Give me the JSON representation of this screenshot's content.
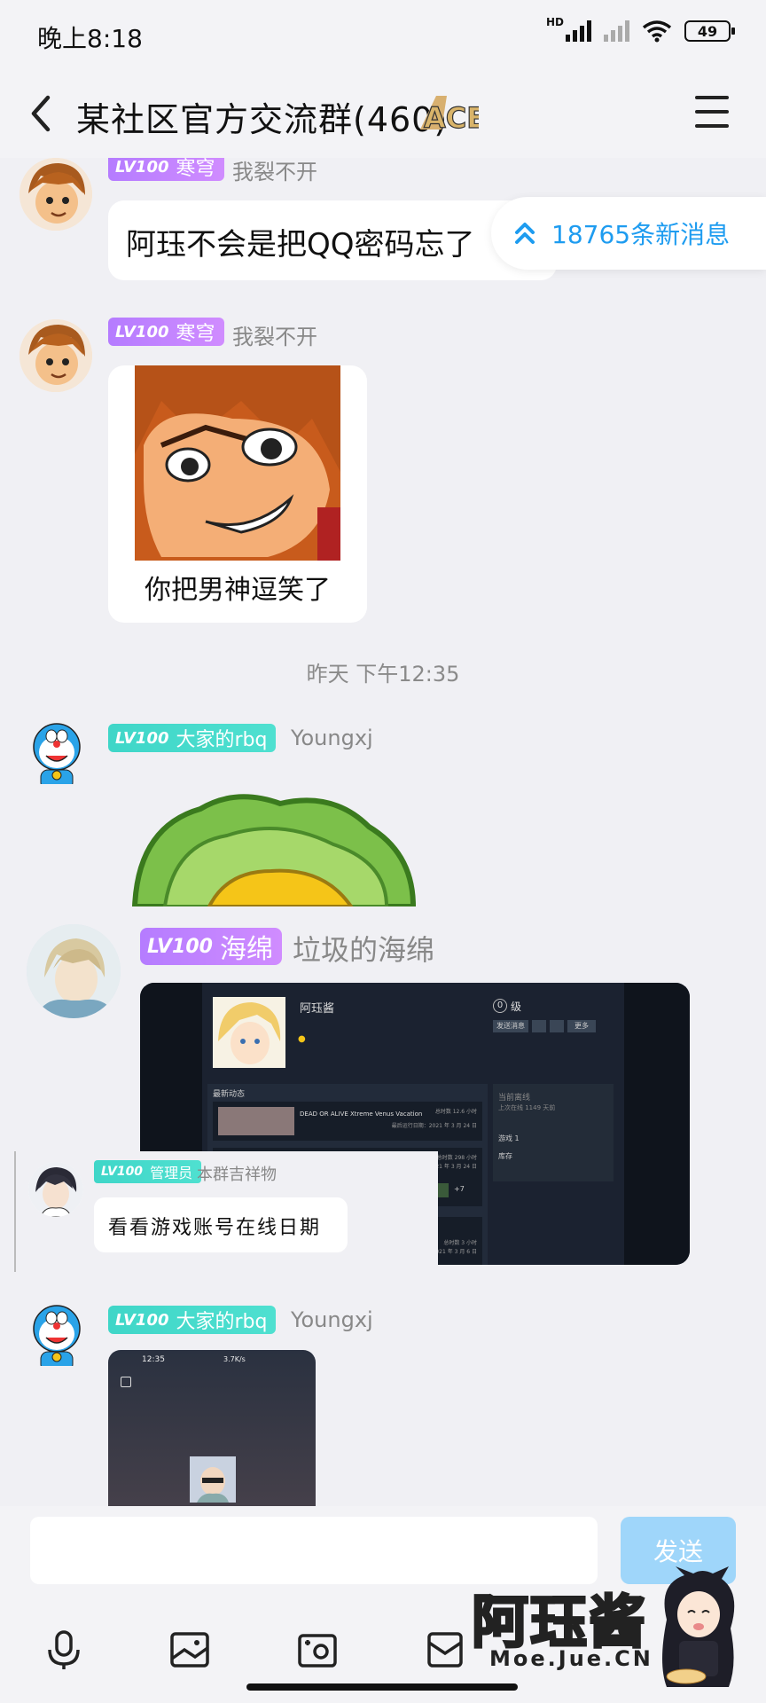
{
  "status_bar": {
    "time": "晚上8:18",
    "network_type": "HD",
    "battery": "49"
  },
  "header": {
    "title": "某社区官方交流群(460)",
    "logo_text": "ACE"
  },
  "new_messages": {
    "label": "18765条新消息"
  },
  "messages": [
    {
      "level": "LV100",
      "title": "寒穹",
      "nickname": "我裂不开",
      "text": "阿珏不会是把QQ密码忘了"
    },
    {
      "level": "LV100",
      "title": "寒穹",
      "nickname": "我裂不开",
      "sticker_caption": "你把男神逗笑了"
    },
    {
      "level": "LV100",
      "title": "大家的rbq",
      "nickname": "Youngxj"
    },
    {
      "level": "LV100",
      "title": "海绵",
      "nickname": "垃圾的海绵",
      "screenshot": {
        "username": "阿珏酱",
        "level_label": "级",
        "level_num": "0",
        "buttons": [
          "发送消息",
          "更多"
        ],
        "recent_label": "最新动态",
        "game1": "DEAD OR ALIVE Xtreme Venus Vacation",
        "game1_hours": "总时数 12.6 小时",
        "game1_date": "最后运行日期：2021 年 3 月 24 日",
        "game2_hours": "总时数 298 小时",
        "game2_date": "2021 年 3 月 24 日",
        "game3_hours": "总时数 3 小时",
        "game3_date": "2021 年 3 月 6 日",
        "offline_title": "当前离线",
        "offline_sub": "上次在线 1149 天前",
        "side_games": "游戏",
        "side_games_count": "1",
        "side_inventory": "库存",
        "more_count": "+7"
      }
    },
    {
      "level": "LV100",
      "title": "管理员",
      "nickname": "本群吉祥物",
      "text": "看看游戏账号在线日期"
    },
    {
      "level": "LV100",
      "title": "大家的rbq",
      "nickname": "Youngxj",
      "phone": {
        "time": "12:35",
        "status": "3.7K/s"
      }
    }
  ],
  "timestamp": "昨天 下午12:35",
  "composer": {
    "send_label": "发送"
  },
  "toolbar": {
    "icons": [
      "mic-icon",
      "image-icon",
      "camera-icon",
      "gift-icon"
    ]
  },
  "watermark": {
    "text": "阿珏酱",
    "sub": "Moe.Jue.CN"
  },
  "colors": {
    "accent": "#1e9cf0",
    "send_button": "#9fd6fa",
    "badge_purple": "#c184ff",
    "badge_teal": "#3fd6c8"
  }
}
